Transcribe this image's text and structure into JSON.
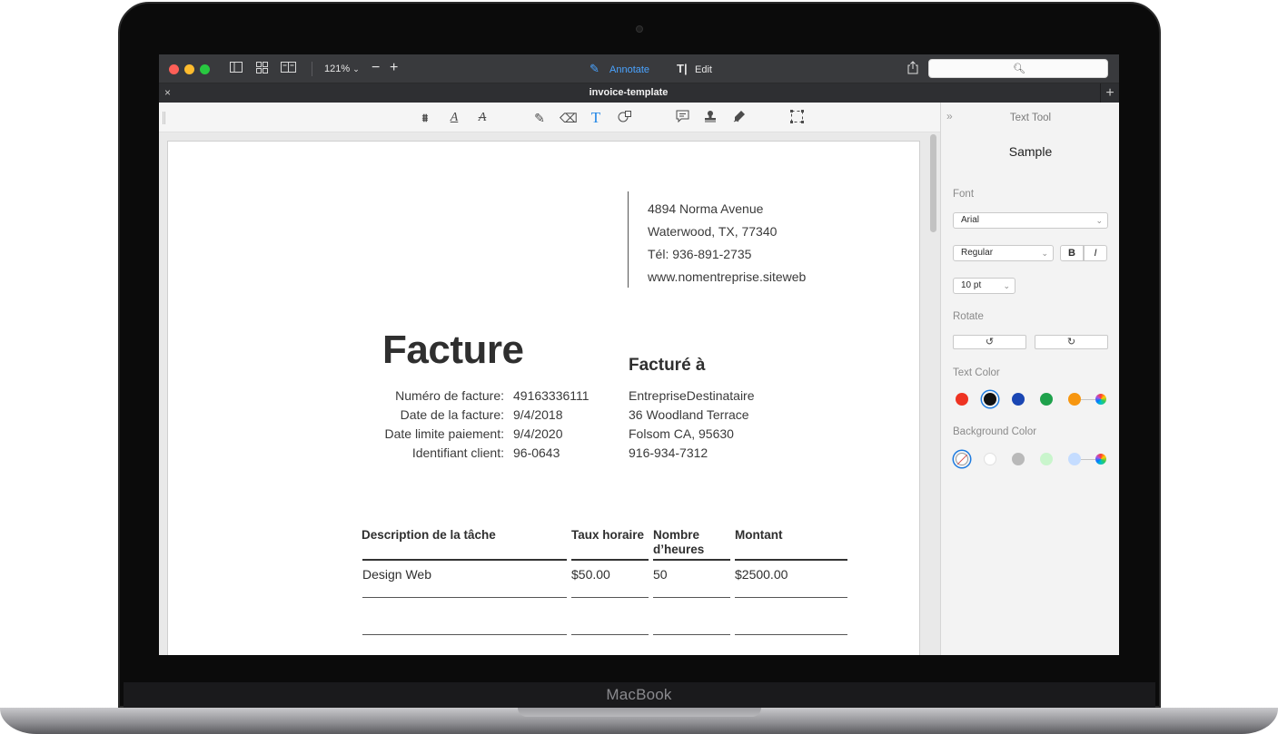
{
  "device": {
    "brand": "MacBook"
  },
  "toolbar": {
    "zoom": "121%",
    "zoom_out": "−",
    "zoom_in": "+",
    "annotate_label": "Annotate",
    "edit_label": "Edit",
    "search_placeholder": ""
  },
  "tab": {
    "title": "invoice-template",
    "close": "×",
    "add": "+"
  },
  "invoice": {
    "address": [
      "4894 Norma Avenue",
      "Waterwood, TX, 77340",
      "Tél: 936-891-2735",
      "www.nomentreprise.siteweb"
    ],
    "title": "Facture",
    "billed_heading": "Facturé à",
    "meta": [
      {
        "label": "Numéro de facture:",
        "value": "49163336111"
      },
      {
        "label": "Date de la facture:",
        "value": "9/4/2018"
      },
      {
        "label": "Date limite paiement:",
        "value": "9/4/2020"
      },
      {
        "label": "Identifiant client:",
        "value": "96-0643"
      }
    ],
    "billed_to": [
      "EntrepriseDestinataire",
      "36 Woodland Terrace",
      "Folsom CA, 95630",
      "916-934-7312"
    ],
    "table": {
      "headers": [
        "Description de la tâche",
        "Taux horaire",
        "Nombre d’heures",
        "Montant"
      ],
      "rows": [
        [
          "Design Web",
          "$50.00",
          "50",
          "$2500.00"
        ]
      ]
    }
  },
  "inspector": {
    "chevron": "»",
    "title": "Text Tool",
    "sample": "Sample",
    "font_label": "Font",
    "font_value": "Arial",
    "style_value": "Regular",
    "bold": "B",
    "italic": "I",
    "size_value": "10 pt",
    "rotate_label": "Rotate",
    "rotate_ccw": "↺",
    "rotate_cw": "↻",
    "text_color_label": "Text Color",
    "text_colors": [
      "#ee3322",
      "#111111",
      "#1a46b3",
      "#1ea14b",
      "#f7960f"
    ],
    "background_color_label": "Background Color",
    "background_colors": [
      "#ffffff",
      "#b9b9b9",
      "#c9f5cc",
      "#c4dcff"
    ]
  }
}
